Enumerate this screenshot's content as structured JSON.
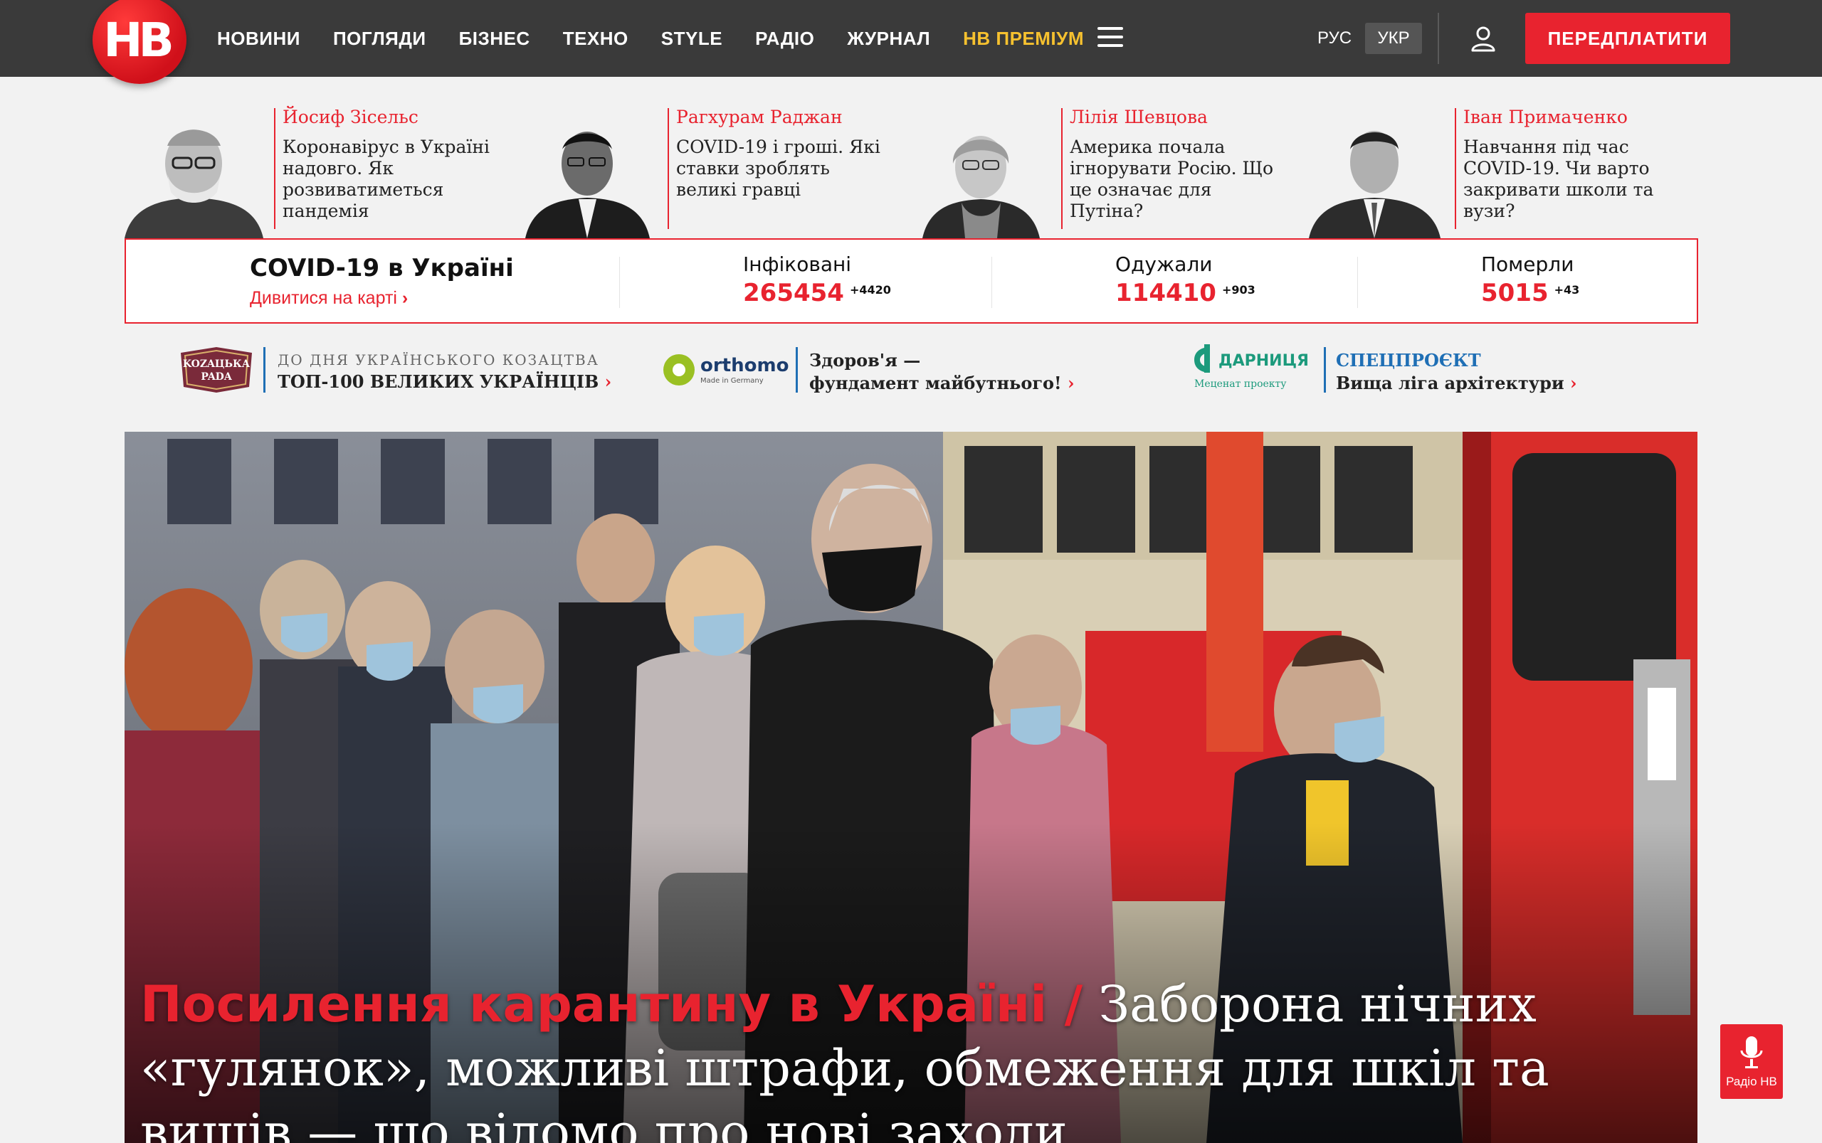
{
  "header": {
    "logo_text": "НВ",
    "nav": [
      "НОВИНИ",
      "ПОГЛЯДИ",
      "БІЗНЕС",
      "ТЕХНО",
      "STYLE",
      "РАДІО",
      "ЖУРНАЛ",
      "НВ ПРЕМІУМ"
    ],
    "lang_ru": "РУС",
    "lang_uk": "УКР",
    "subscribe_label": "ПЕРЕДПЛАТИТИ",
    "accent": "#e8232f",
    "premium_color": "#f6c12f"
  },
  "opinions": [
    {
      "author": "Йосиф Зісельс",
      "title": "Коронавірус в Україні надовго. Як розвиватиметься пандемія"
    },
    {
      "author": "Рагхурам Раджан",
      "title": "COVID-19 і гроші. Які ставки зроблять великі гравці"
    },
    {
      "author": "Лілія Шевцова",
      "title": "Америка почала ігнорувати Росію. Що це означає для Путіна?"
    },
    {
      "author": "Іван Примаченко",
      "title": "Навчання під час COVID-19. Чи варто закривати школи та вузи?"
    }
  ],
  "covid": {
    "title": "COVID-19 в Україні",
    "map_link": "Дивитися на карті",
    "stats": [
      {
        "label": "Інфіковані",
        "value": "265454",
        "delta": "+4420"
      },
      {
        "label": "Одужали",
        "value": "114410",
        "delta": "+903"
      },
      {
        "label": "Померли",
        "value": "5015",
        "delta": "+43"
      }
    ]
  },
  "partners": [
    {
      "logo": "КОЗАЦЬКА РАДА",
      "line1": "ДО ДНЯ УКРАЇНСЬКОГО КОЗАЦТВА",
      "line2": "ТОП-100 ВЕЛИКИХ УКРАЇНЦІВ"
    },
    {
      "logo": "orthomol",
      "logo_sub": "Made in Germany",
      "line1": "Здоров'я —",
      "line2": "фундамент майбутнього!"
    },
    {
      "logo": "ДАРНИЦЯ",
      "logo_sub": "Меценат проекту",
      "line1": "СПЕЦПРОЄКТ",
      "line2": "Вища ліга архітектури"
    }
  ],
  "hero": {
    "category": "Посилення карантину в Україні /",
    "headline": "Заборона нічних «гулянок», можливі штрафи, обмеження для шкіл та вишів — що відомо про нові заходи"
  },
  "radio_widget": {
    "label": "Радіо НВ"
  }
}
